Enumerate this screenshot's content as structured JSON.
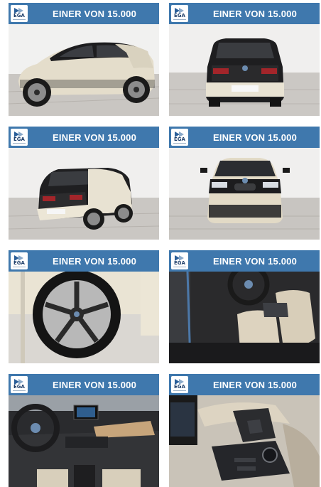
{
  "listing": {
    "badge": {
      "logo_text": "EGA",
      "banner_color": "#3f78ad"
    },
    "cards": [
      {
        "title": "EINER VON 15.000",
        "photo": "side-view"
      },
      {
        "title": "EINER VON 15.000",
        "photo": "rear-view"
      },
      {
        "title": "EINER VON 15.000",
        "photo": "rear-three-quarter-view"
      },
      {
        "title": "EINER VON 15.000",
        "photo": "front-view"
      },
      {
        "title": "EINER VON 15.000",
        "photo": "wheel-closeup"
      },
      {
        "title": "EINER VON 15.000",
        "photo": "interior-seats"
      },
      {
        "title": "EINER VON 15.000",
        "photo": "dashboard"
      },
      {
        "title": "EINER VON 15.000",
        "photo": "center-console"
      }
    ]
  }
}
